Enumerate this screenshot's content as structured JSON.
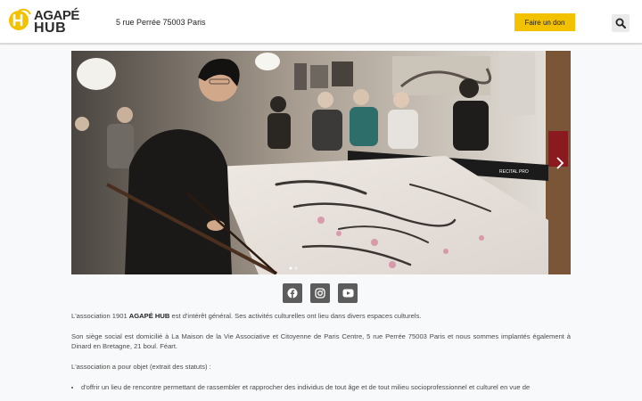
{
  "header": {
    "logo_line1": "AGAPÉ",
    "logo_line2": "HUB",
    "address": "5 rue Perrée 75003 Paris",
    "donate_label": "Faire un don",
    "search_icon": "search-icon"
  },
  "slider": {
    "image_description": "artist-painting-photo",
    "next_icon": "chevron-right-icon",
    "banner_text": "RECITAL PRO"
  },
  "social": [
    {
      "name": "facebook-icon"
    },
    {
      "name": "instagram-icon"
    },
    {
      "name": "youtube-icon"
    }
  ],
  "content": {
    "p1_prefix": "L'association 1901 ",
    "p1_bold": "AGAPÉ HUB",
    "p1_suffix": " est d'intérêt général. Ses activités culturelles ont lieu dans divers espaces culturels.",
    "p2": "Son siège social est domicilié à La Maison de la Vie Associative et Citoyenne de Paris Centre, 5 rue Perrée 75003 Paris et nous sommes implantés également à Dinard en Bretagne, 21 boul. Féart.",
    "p3": "L'association a pour objet (extrait des statuts) :",
    "bullet1": "d'offrir un lieu de rencontre permettant de rassembler et rapprocher des individus de tout âge et de tout milieu socioprofessionnel et culturel en vue de"
  },
  "colors": {
    "accent": "#f2c200",
    "social_bg": "#5c5c5c"
  }
}
